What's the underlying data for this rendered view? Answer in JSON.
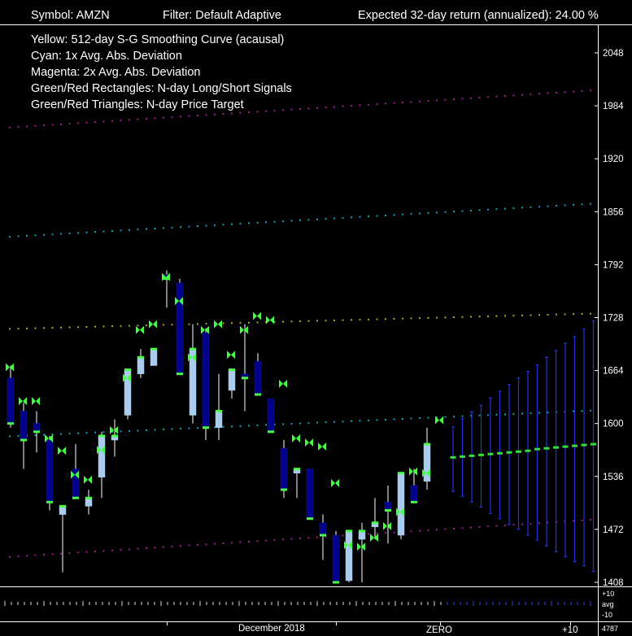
{
  "header": {
    "symbol": "Symbol: AMZN",
    "filter": "Filter: Default Adaptive",
    "expected_return": "Expected 32-day return (annualized):   24.00 %"
  },
  "legend": [
    "Yellow: 512-day S-G Smoothing Curve (acausal)",
    "Cyan:        1x Avg. Abs. Deviation",
    "Magenta: 2x Avg. Abs. Deviation",
    "Green/Red Rectangles: N-day Long/Short Signals",
    "Green/Red Triangles:      N-day Price Target"
  ],
  "indicator_labels": {
    "upper": "+10",
    "mid": "avg",
    "lower": "-10",
    "volume": "4787"
  },
  "colors": {
    "up_candle": "#aaccee",
    "down_candle": "#000088",
    "smooth": "#aaaa22",
    "band1": "#11a0b8",
    "band2": "#9a1f8e",
    "signal": "#44ff44",
    "forecast": "#2233dd",
    "forecast_mid": "#33dd33"
  },
  "chart_data": {
    "type": "candlestick",
    "title": "",
    "y_ticks": [
      2048,
      1984,
      1920,
      1856,
      1792,
      1728,
      1664,
      1600,
      1536,
      1472,
      1408
    ],
    "ylim": [
      1405,
      2085
    ],
    "x_labels": {
      "month": "December 2018",
      "zero": "ZERO",
      "plus": "+10"
    },
    "candles": [
      {
        "o": 1655,
        "h": 1670,
        "l": 1595,
        "c": 1600
      },
      {
        "o": 1615,
        "h": 1625,
        "l": 1545,
        "c": 1580
      },
      {
        "o": 1600,
        "h": 1615,
        "l": 1565,
        "c": 1590
      },
      {
        "o": 1580,
        "h": 1585,
        "l": 1495,
        "c": 1505
      },
      {
        "o": 1490,
        "h": 1500,
        "l": 1420,
        "c": 1500
      },
      {
        "o": 1545,
        "h": 1575,
        "l": 1545,
        "c": 1510
      },
      {
        "o": 1500,
        "h": 1520,
        "l": 1490,
        "c": 1510
      },
      {
        "o": 1535,
        "h": 1590,
        "l": 1510,
        "c": 1585
      },
      {
        "o": 1580,
        "h": 1605,
        "l": 1560,
        "c": 1585
      },
      {
        "o": 1610,
        "h": 1665,
        "l": 1605,
        "c": 1665
      },
      {
        "o": 1660,
        "h": 1690,
        "l": 1655,
        "c": 1680
      },
      {
        "o": 1670,
        "h": 1690,
        "l": 1670,
        "c": 1690
      },
      {
        "o": 1780,
        "h": 1785,
        "l": 1740,
        "c": 1775
      },
      {
        "o": 1770,
        "h": 1775,
        "l": 1700,
        "c": 1660
      },
      {
        "o": 1610,
        "h": 1720,
        "l": 1600,
        "c": 1690
      },
      {
        "o": 1710,
        "h": 1715,
        "l": 1580,
        "c": 1595
      },
      {
        "o": 1595,
        "h": 1660,
        "l": 1580,
        "c": 1615
      },
      {
        "o": 1640,
        "h": 1665,
        "l": 1630,
        "c": 1665
      },
      {
        "o": 1660,
        "h": 1720,
        "l": 1615,
        "c": 1655
      },
      {
        "o": 1675,
        "h": 1685,
        "l": 1650,
        "c": 1635
      },
      {
        "o": 1630,
        "h": 1630,
        "l": 1595,
        "c": 1590
      },
      {
        "o": 1570,
        "h": 1580,
        "l": 1510,
        "c": 1520
      },
      {
        "o": 1540,
        "h": 1545,
        "l": 1510,
        "c": 1545
      },
      {
        "o": 1545,
        "h": 1545,
        "l": 1490,
        "c": 1485
      },
      {
        "o": 1480,
        "h": 1490,
        "l": 1435,
        "c": 1465
      },
      {
        "o": 1465,
        "h": 1470,
        "l": 1408,
        "c": 1408
      },
      {
        "o": 1410,
        "h": 1470,
        "l": 1408,
        "c": 1470
      },
      {
        "o": 1460,
        "h": 1480,
        "l": 1408,
        "c": 1470
      },
      {
        "o": 1475,
        "h": 1510,
        "l": 1460,
        "c": 1480
      },
      {
        "o": 1505,
        "h": 1525,
        "l": 1455,
        "c": 1495
      },
      {
        "o": 1465,
        "h": 1530,
        "l": 1460,
        "c": 1540
      },
      {
        "o": 1525,
        "h": 1545,
        "l": 1505,
        "c": 1505
      },
      {
        "o": 1530,
        "h": 1595,
        "l": 1520,
        "c": 1575
      }
    ],
    "signals": [
      1668,
      1627,
      1627,
      1582,
      1567,
      1538,
      1532,
      1568,
      1592,
      1655,
      1713,
      1720,
      1777,
      1748,
      1680,
      1713,
      1720,
      1683,
      1713,
      1730,
      1725,
      1648,
      1582,
      1577,
      1572,
      1528,
      1453,
      1451,
      1462,
      1476,
      1493,
      1542,
      1540,
      1604
    ],
    "smooth_curve": {
      "start": 1714,
      "end": 1733
    },
    "band1_upper": {
      "start": 1825,
      "end": 1866
    },
    "band1_lower": {
      "start": 1584,
      "end": 1616
    },
    "band2_upper": {
      "start": 1957,
      "end": 2003
    },
    "band2_lower": {
      "start": 1438,
      "end": 1484
    },
    "forecast": [
      {
        "mid": 1559,
        "lo": 1518,
        "hi": 1596
      },
      {
        "mid": 1560,
        "lo": 1512,
        "hi": 1606
      },
      {
        "mid": 1561,
        "lo": 1505,
        "hi": 1614
      },
      {
        "mid": 1562,
        "lo": 1499,
        "hi": 1622
      },
      {
        "mid": 1563,
        "lo": 1491,
        "hi": 1631
      },
      {
        "mid": 1564,
        "lo": 1485,
        "hi": 1639
      },
      {
        "mid": 1565,
        "lo": 1478,
        "hi": 1647
      },
      {
        "mid": 1566,
        "lo": 1472,
        "hi": 1655
      },
      {
        "mid": 1567,
        "lo": 1465,
        "hi": 1663
      },
      {
        "mid": 1569,
        "lo": 1459,
        "hi": 1671
      },
      {
        "mid": 1570,
        "lo": 1452,
        "hi": 1680
      },
      {
        "mid": 1571,
        "lo": 1445,
        "hi": 1688
      },
      {
        "mid": 1572,
        "lo": 1439,
        "hi": 1697
      },
      {
        "mid": 1573,
        "lo": 1433,
        "hi": 1705
      },
      {
        "mid": 1574,
        "lo": 1428,
        "hi": 1714
      },
      {
        "mid": 1575,
        "lo": 1421,
        "hi": 1724
      }
    ]
  }
}
